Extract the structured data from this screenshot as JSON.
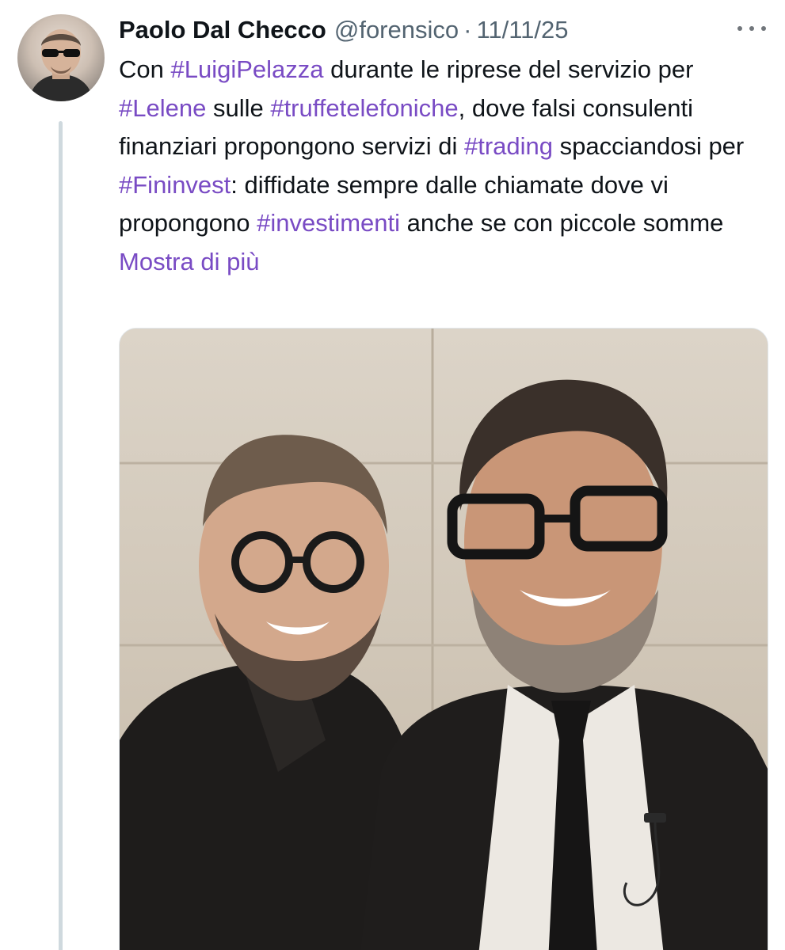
{
  "tweet": {
    "author_name": "Paolo Dal Checco",
    "handle": "@forensico",
    "separator": "·",
    "date": "11/11/25",
    "body": [
      {
        "t": "text",
        "v": "Con "
      },
      {
        "t": "tag",
        "v": "#LuigiPelazza"
      },
      {
        "t": "text",
        "v": " durante le riprese del servizio per "
      },
      {
        "t": "tag",
        "v": "#Lelene"
      },
      {
        "t": "text",
        "v": " sulle "
      },
      {
        "t": "tag",
        "v": "#truffetelefoniche"
      },
      {
        "t": "text",
        "v": ", dove falsi consulenti finanziari propongono servizi di "
      },
      {
        "t": "tag",
        "v": "#trading"
      },
      {
        "t": "text",
        "v": " spacciandosi per "
      },
      {
        "t": "tag",
        "v": "#Fininvest"
      },
      {
        "t": "text",
        "v": ": diffidate sempre dalle chiamate dove vi propongono "
      },
      {
        "t": "tag",
        "v": "#investimenti"
      },
      {
        "t": "text",
        "v": " anche se con piccole somme "
      }
    ],
    "show_more": "Mostra di più"
  },
  "icons": {
    "more": "more-horizontal-icon"
  },
  "colors": {
    "text": "#0f1419",
    "secondary": "#536471",
    "link": "#794bc4",
    "thread_line": "#cfd9de"
  }
}
